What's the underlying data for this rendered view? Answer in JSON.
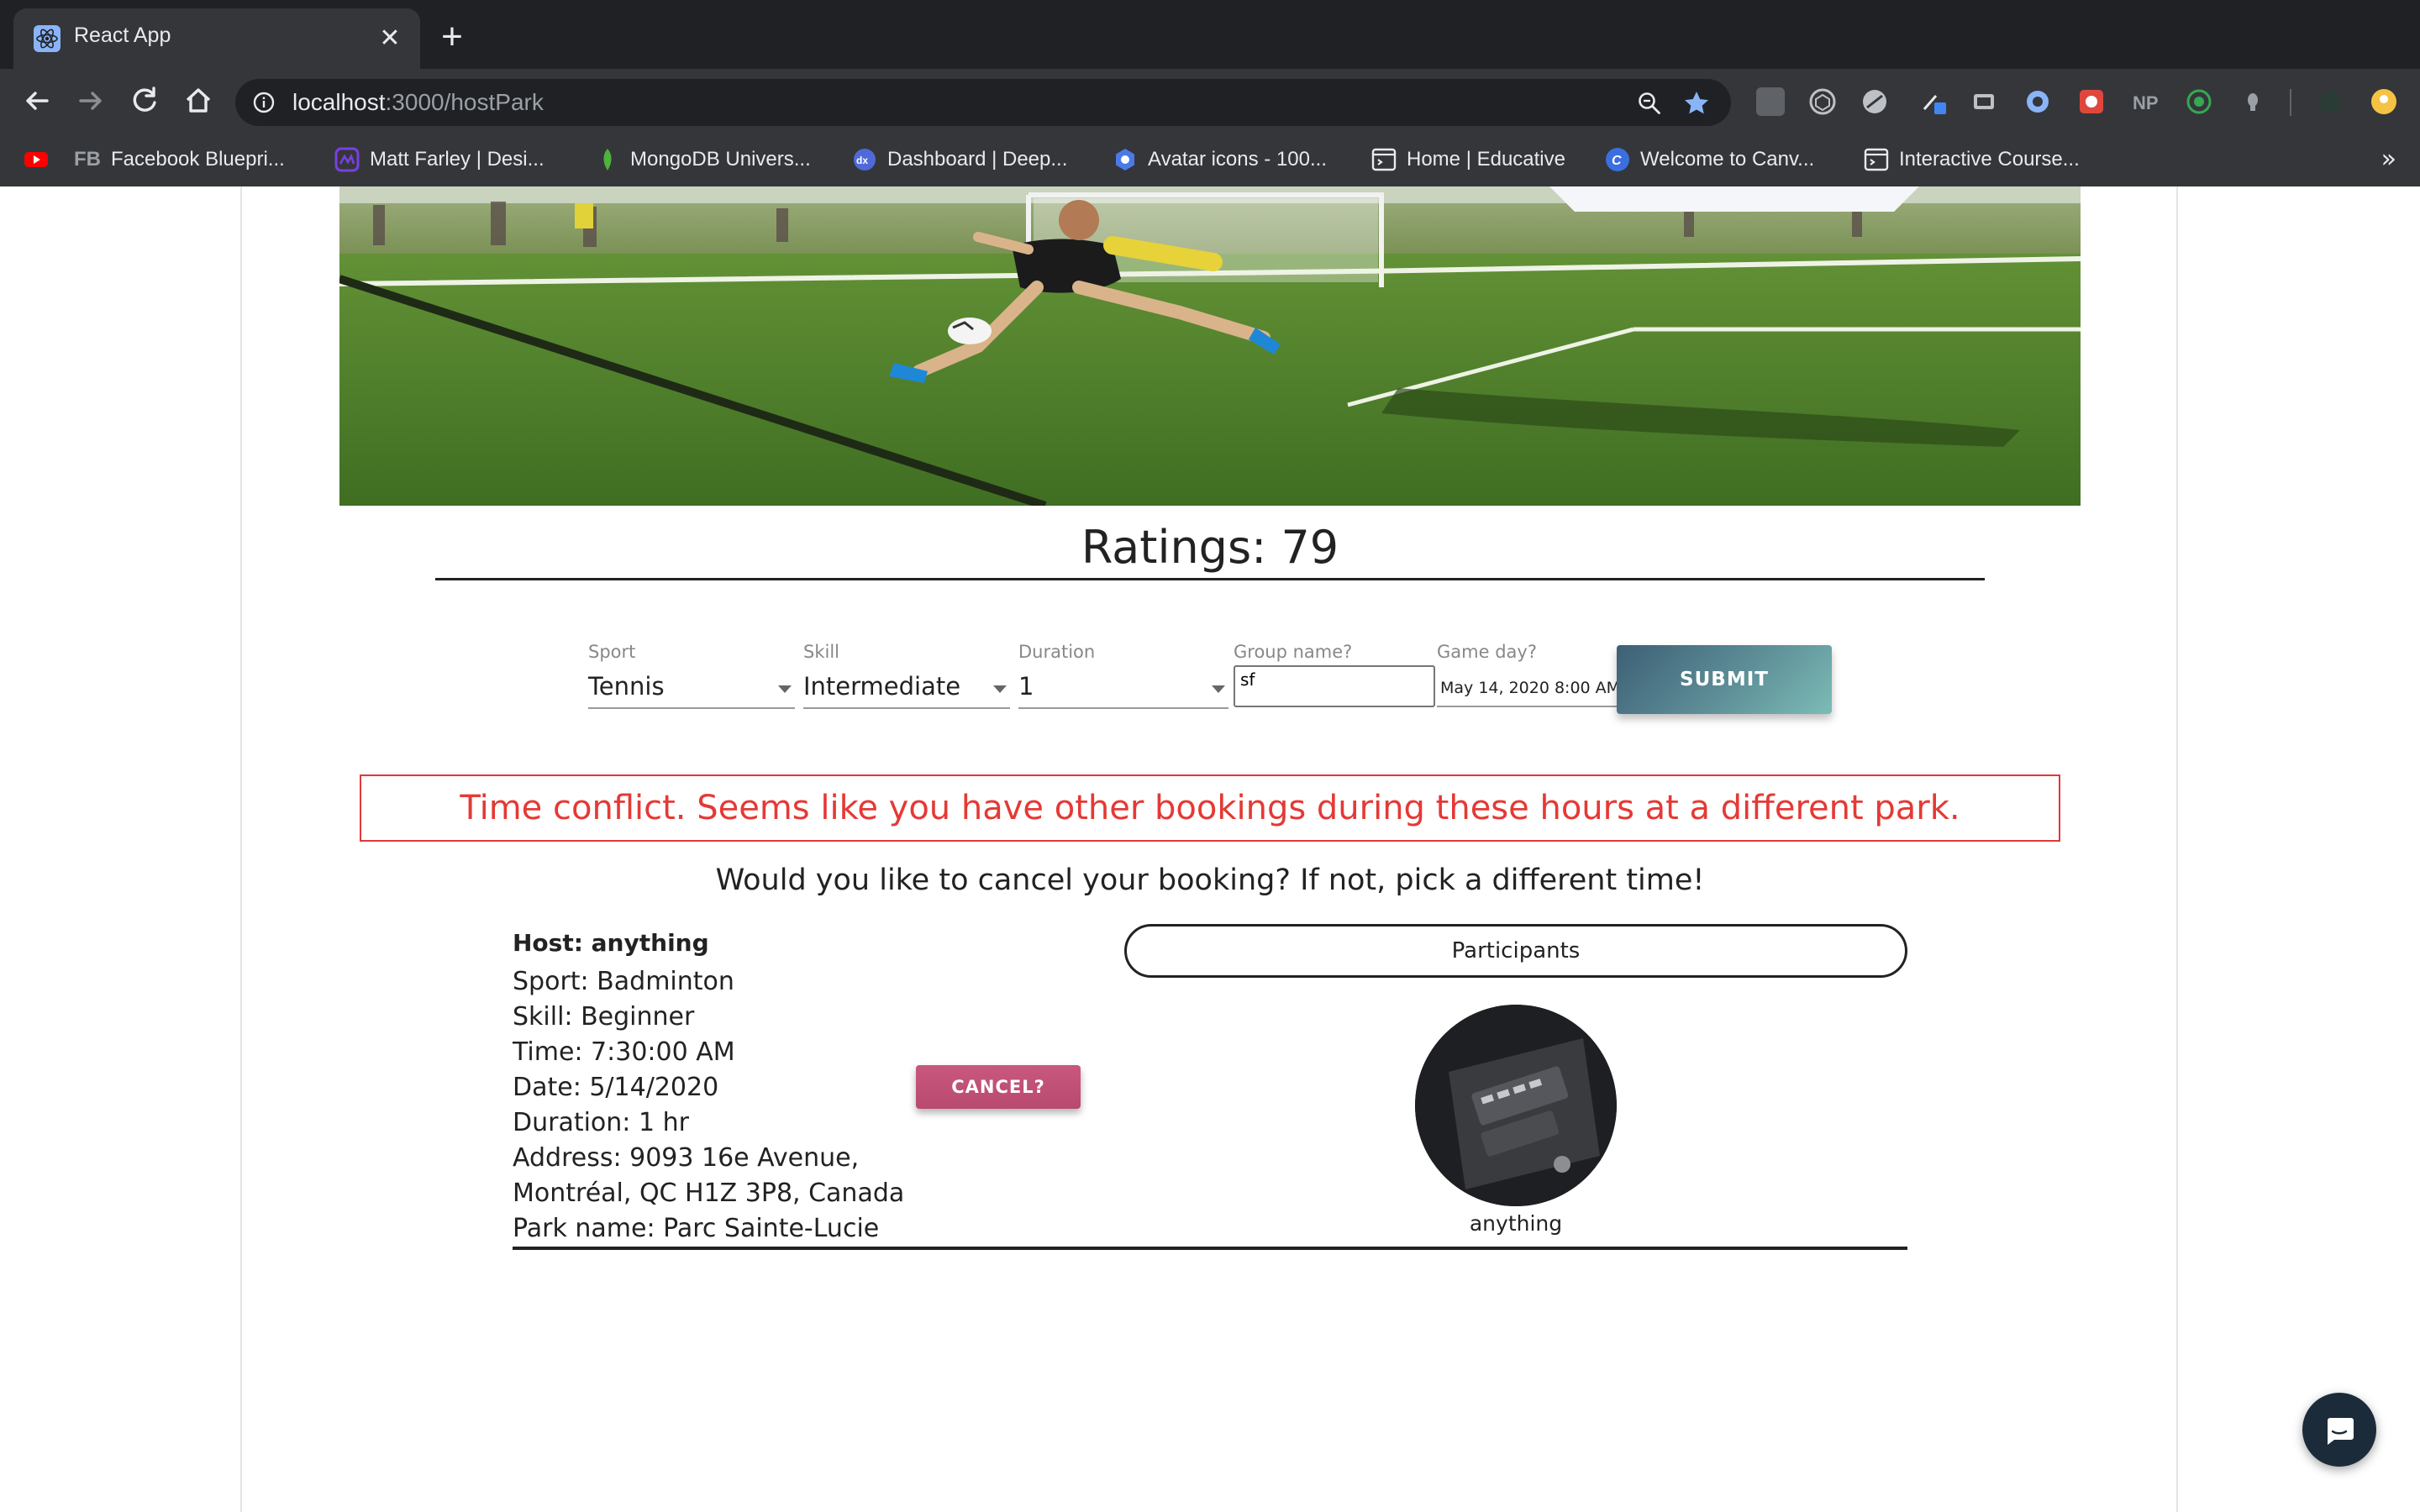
{
  "browser": {
    "tab_title": "React App",
    "url_host": "localhost",
    "url_rest": ":3000/hostPark",
    "bookmarks": [
      {
        "label": "",
        "icon": "youtube-icon",
        "color": "#ff0000"
      },
      {
        "label": "Facebook Bluepri...",
        "icon": "fb-text-icon",
        "color": "#9aa0a6"
      },
      {
        "label": "Matt Farley | Desi...",
        "icon": "matt-farley-icon",
        "color": "#7b3fe4"
      },
      {
        "label": "MongoDB Univers...",
        "icon": "mongodb-leaf-icon",
        "color": "#4db33d"
      },
      {
        "label": "Dashboard | Deep...",
        "icon": "deeplearning-icon",
        "color": "#4f6ad8"
      },
      {
        "label": "Avatar icons - 100...",
        "icon": "avatar-hex-icon",
        "color": "#4a7ae8"
      },
      {
        "label": "Home | Educative",
        "icon": "educative-icon",
        "color": "#e8eaed"
      },
      {
        "label": "Welcome to Canv...",
        "icon": "canva-icon",
        "color": "#3b6fe0"
      },
      {
        "label": "Interactive Course...",
        "icon": "course-icon",
        "color": "#e8eaed"
      }
    ],
    "bookmarks_more": "»"
  },
  "page": {
    "ratings": "Ratings: 79",
    "form": {
      "sport_label": "Sport",
      "sport_value": "Tennis",
      "skill_label": "Skill",
      "skill_value": "Intermediate",
      "duration_label": "Duration",
      "duration_value": "1",
      "group_label": "Group name?",
      "group_value": "sf",
      "gameday_label": "Game day?",
      "gameday_value": "May 14, 2020 8:00 AM",
      "submit_label": "SUBMIT"
    },
    "alert": "Time conflict. Seems like you have other bookings during these hours at a different park.",
    "question": "Would you like to cancel your booking? If not, pick a different time!",
    "booking": {
      "host": "Host: anything",
      "sport": "Sport: Badminton",
      "skill": "Skill: Beginner",
      "time": "Time: 7:30:00 AM",
      "date": "Date: 5/14/2020",
      "duration": "Duration: 1 hr",
      "address": "Address: 9093 16e Avenue, Montréal, QC H1Z 3P8, Canada",
      "park": "Park name: Parc Sainte-Lucie"
    },
    "cancel_label": "CANCEL?",
    "participants_label": "Participants",
    "participant_name": "anything"
  },
  "colors": {
    "alert_red": "#e53935",
    "submit_start": "#3d5f75",
    "submit_end": "#7cbcb6",
    "cancel_pink": "#c9587e",
    "chrome_dark": "#202124"
  }
}
